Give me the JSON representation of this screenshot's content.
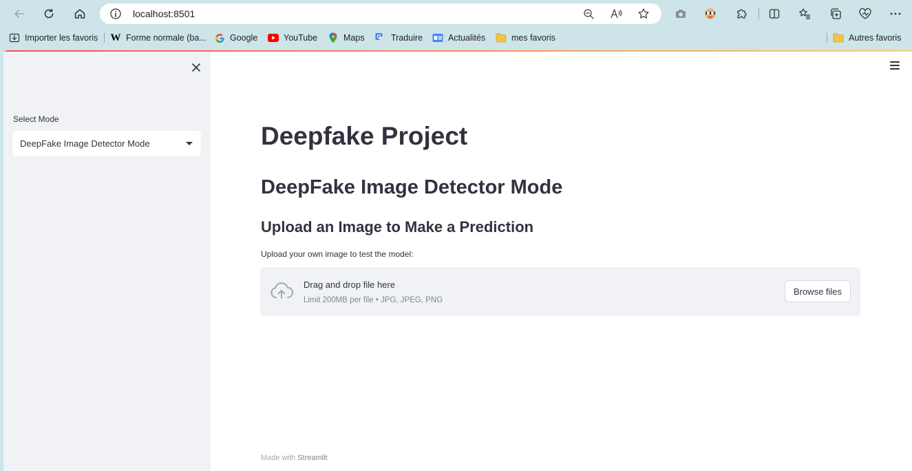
{
  "browser": {
    "url": "localhost:8501",
    "bookmarks": [
      {
        "label": "Importer les favoris",
        "icon": "import-favorites-icon"
      },
      {
        "label": "Forme normale (ba...",
        "icon": "wikipedia-icon"
      },
      {
        "label": "Google",
        "icon": "google-icon"
      },
      {
        "label": "YouTube",
        "icon": "youtube-icon"
      },
      {
        "label": "Maps",
        "icon": "maps-icon"
      },
      {
        "label": "Traduire",
        "icon": "translate-icon"
      },
      {
        "label": "Actualités",
        "icon": "news-icon"
      },
      {
        "label": "mes favoris",
        "icon": "folder-icon"
      }
    ],
    "other_favorites": "Autres favoris"
  },
  "sidebar": {
    "select_label": "Select Mode",
    "selected_mode": "DeepFake Image Detector Mode"
  },
  "main": {
    "title": "Deepfake Project",
    "subtitle": "DeepFake Image Detector Mode",
    "section_title": "Upload an Image to Make a Prediction",
    "uploader": {
      "label": "Upload your own image to test the model:",
      "drop_text": "Drag and drop file here",
      "limit_text": "Limit 200MB per file • JPG, JPEG, PNG",
      "browse_label": "Browse files"
    },
    "footer_prefix": "Made with",
    "footer_brand": "Streamlit"
  },
  "colors": {
    "sidebar_bg": "#f0f2f6",
    "text": "#31333f",
    "accent_gradient_start": "#ff4b4b",
    "accent_gradient_end": "#ffd16a",
    "chrome_bg": "#cde4e9"
  }
}
